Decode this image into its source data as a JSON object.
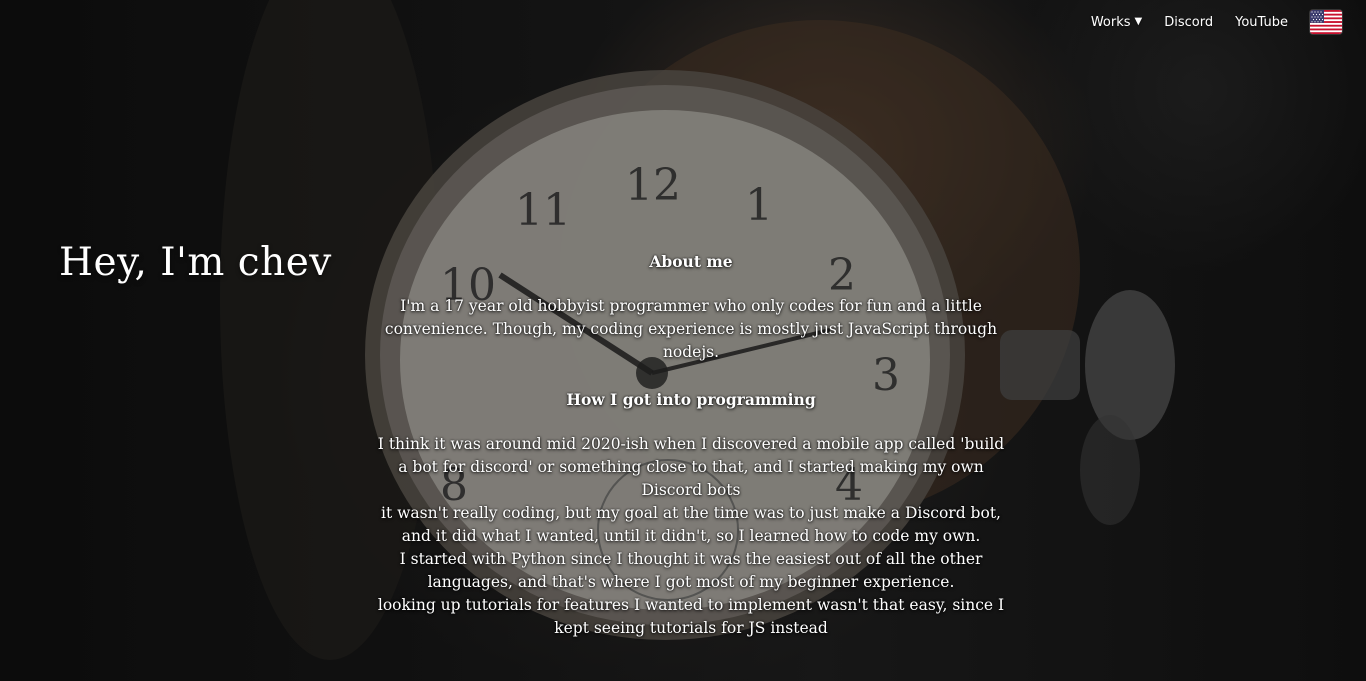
{
  "nav": {
    "works_label": "Works",
    "works_caret": "▼",
    "discord_label": "Discord",
    "youtube_label": "YouTube",
    "language_flag_icon": "us-flag-icon"
  },
  "hero": {
    "title": "Hey, I'm chev"
  },
  "about": {
    "heading": "About me",
    "paragraph": "I'm a 17 year old hobbyist programmer who only codes for fun and a little convenience. Though, my coding experience is mostly just JavaScript through nodejs."
  },
  "programming": {
    "heading": "How I got into programming",
    "lines": [
      "I think it was around mid 2020-ish when I discovered a mobile app called 'build a bot for discord' or something close to that, and I started making my own Discord bots",
      "it wasn't really coding, but my goal at the time was to just make a Discord bot, and it did what I wanted, until it didn't, so I learned how to code my own.",
      "I started with Python since I thought it was the easiest out of all the other languages, and that's where I got most of my beginner experience.",
      "looking up tutorials for features I wanted to implement wasn't that easy, since I kept seeing tutorials for JS instead"
    ]
  },
  "colors": {
    "text": "#ffffff",
    "background": "#141414"
  }
}
